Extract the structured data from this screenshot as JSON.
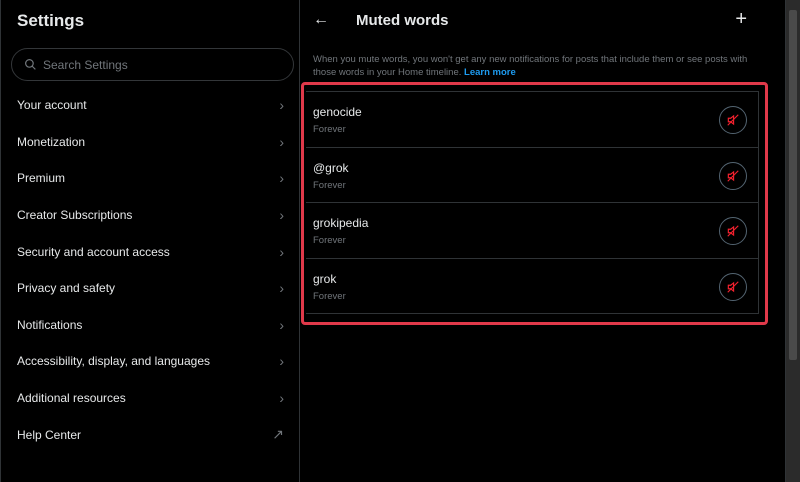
{
  "sidebar": {
    "title": "Settings",
    "search_placeholder": "Search Settings",
    "items": [
      {
        "label": "Your account",
        "icon": "chevron-right"
      },
      {
        "label": "Monetization",
        "icon": "chevron-right"
      },
      {
        "label": "Premium",
        "icon": "chevron-right"
      },
      {
        "label": "Creator Subscriptions",
        "icon": "chevron-right"
      },
      {
        "label": "Security and account access",
        "icon": "chevron-right"
      },
      {
        "label": "Privacy and safety",
        "icon": "chevron-right"
      },
      {
        "label": "Notifications",
        "icon": "chevron-right"
      },
      {
        "label": "Accessibility, display, and languages",
        "icon": "chevron-right"
      },
      {
        "label": "Additional resources",
        "icon": "chevron-right"
      },
      {
        "label": "Help Center",
        "icon": "external-arrow"
      }
    ]
  },
  "main": {
    "title": "Muted words",
    "description": "When you mute words, you won't get any new notifications for posts that include them or see posts with those words in your Home timeline.",
    "learn_more": "Learn more",
    "muted": [
      {
        "word": "genocide",
        "duration": "Forever"
      },
      {
        "word": "@grok",
        "duration": "Forever"
      },
      {
        "word": "grokipedia",
        "duration": "Forever"
      },
      {
        "word": "grok",
        "duration": "Forever"
      }
    ]
  },
  "colors": {
    "accent": "#1d9bf0",
    "highlight": "#e0394a",
    "unmute": "#f4212e"
  }
}
